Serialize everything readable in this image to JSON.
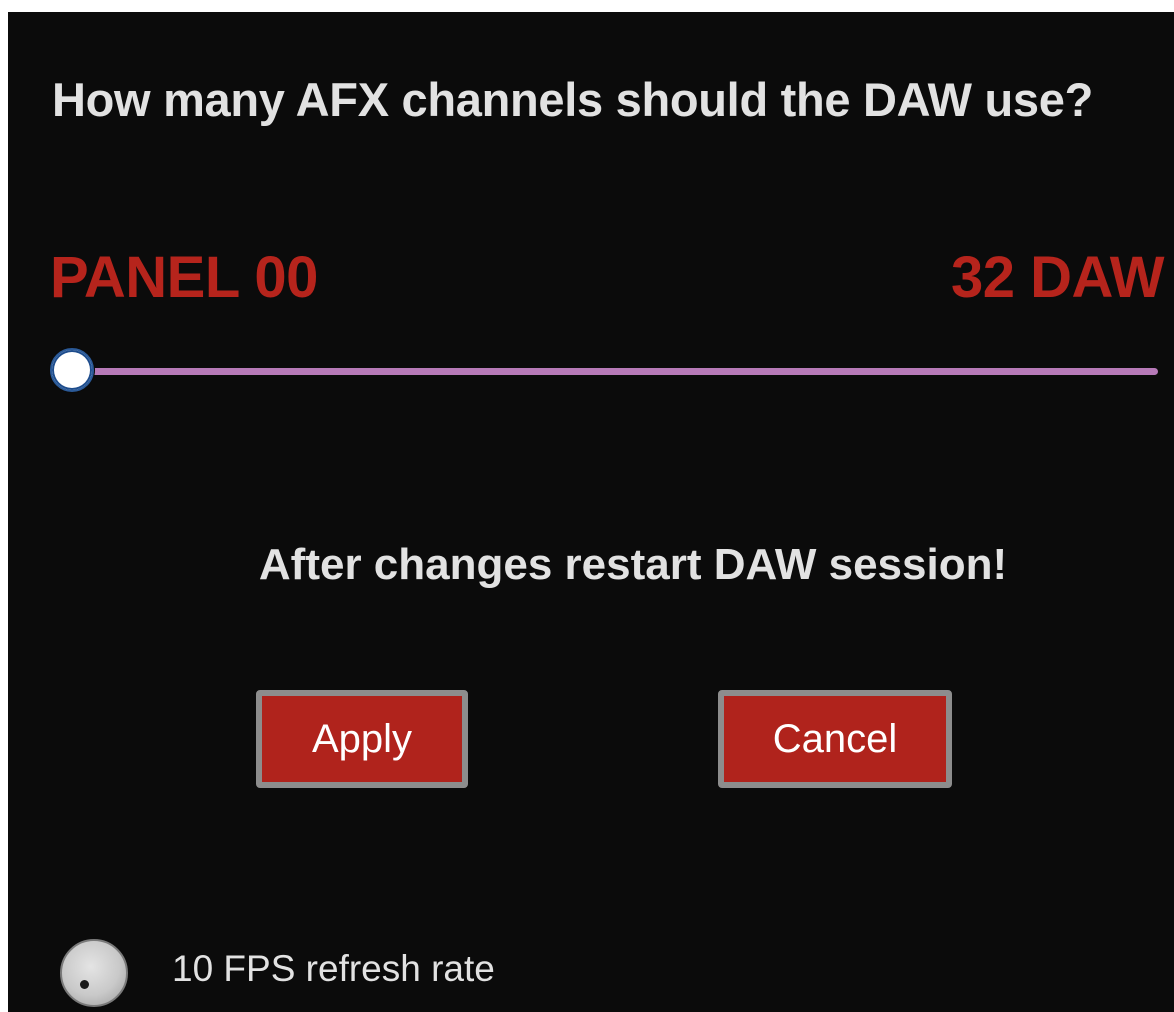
{
  "dialog": {
    "question": "How many AFX channels should the DAW use?",
    "range": {
      "min_label": "PANEL 00",
      "max_label": "32 DAW"
    },
    "slider": {
      "value_fraction": 0.0,
      "track_color": "#b77ab8",
      "thumb_color": "#ffffff"
    },
    "notice": "After changes restart DAW session!",
    "buttons": {
      "apply_label": "Apply",
      "cancel_label": "Cancel",
      "fill_color": "#b0231c",
      "border_color": "#8d8d8d"
    },
    "fps_option": {
      "label": "10 FPS refresh rate",
      "icon": "knob-icon"
    }
  },
  "colors": {
    "background": "#0b0b0b",
    "text": "#e2e2e2",
    "accent_red": "#b6241c"
  }
}
